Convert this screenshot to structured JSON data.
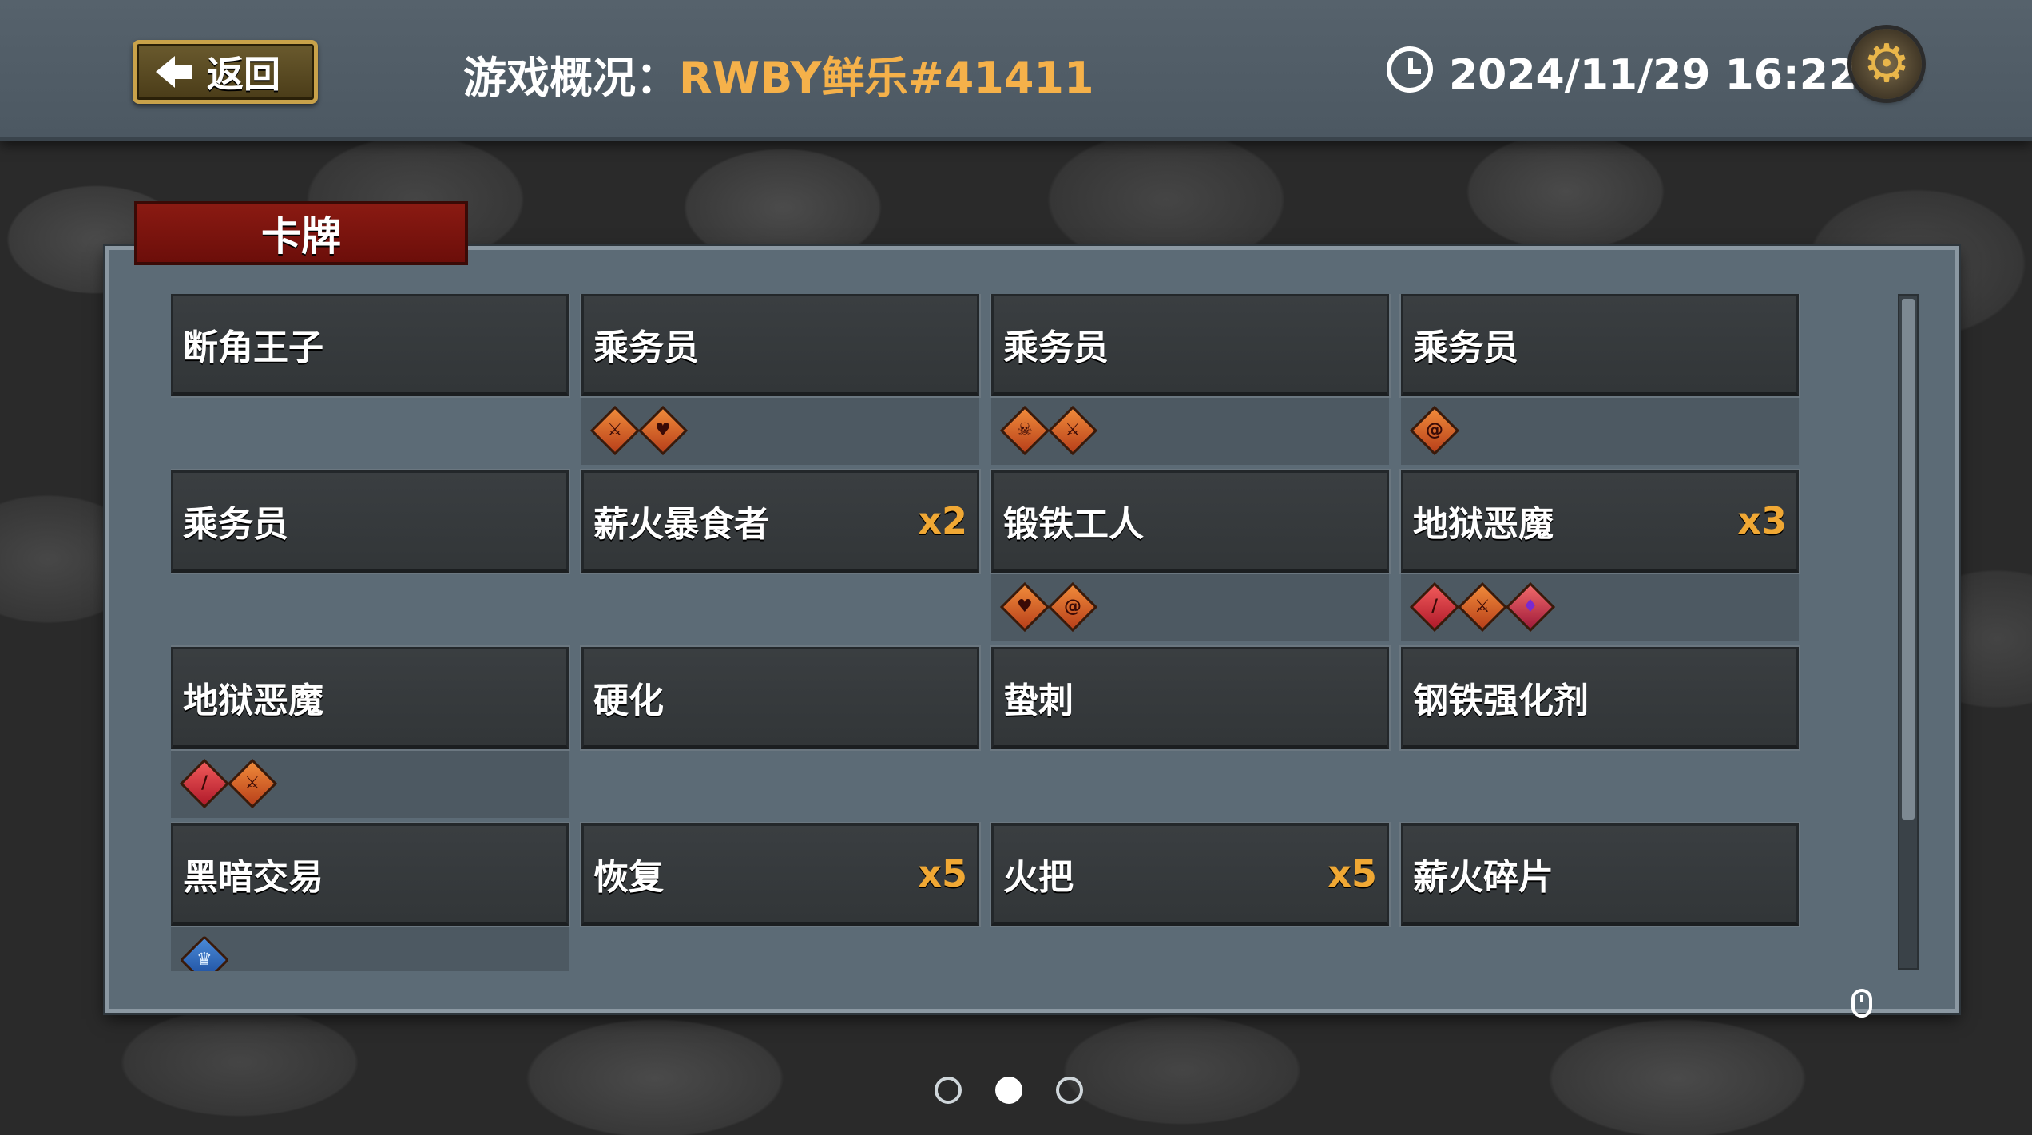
{
  "header": {
    "back_label": "返回",
    "title_prefix": "游戏概况：",
    "player_name": "RWBY鲜乐#41411",
    "datetime": "2024/11/29 16:22"
  },
  "panel": {
    "tab_label": "卡牌"
  },
  "cards": [
    {
      "name": "断角王子",
      "count": "",
      "tags": []
    },
    {
      "name": "乘务员",
      "count": "",
      "tags": [
        {
          "icon": "sword-icon",
          "glyph": "⚔",
          "kind": "orange"
        },
        {
          "icon": "heart-icon",
          "glyph": "♥",
          "kind": "orange"
        }
      ]
    },
    {
      "name": "乘务员",
      "count": "",
      "tags": [
        {
          "icon": "demon-icon",
          "glyph": "☠",
          "kind": "orange"
        },
        {
          "icon": "sword-icon",
          "glyph": "⚔",
          "kind": "orange"
        }
      ]
    },
    {
      "name": "乘务员",
      "count": "",
      "tags": [
        {
          "icon": "spiral-icon",
          "glyph": "@",
          "kind": "orange"
        }
      ]
    },
    {
      "name": "乘务员",
      "count": "",
      "tags": []
    },
    {
      "name": "薪火暴食者",
      "count": "x2",
      "tags": []
    },
    {
      "name": "锻铁工人",
      "count": "",
      "tags": [
        {
          "icon": "heart-icon",
          "glyph": "♥",
          "kind": "orange"
        },
        {
          "icon": "spiral-icon",
          "glyph": "@",
          "kind": "orange"
        }
      ]
    },
    {
      "name": "地狱恶魔",
      "count": "x3",
      "tags": [
        {
          "icon": "slash-icon",
          "glyph": "/",
          "kind": "red"
        },
        {
          "icon": "sword-icon",
          "glyph": "⚔",
          "kind": "orange"
        },
        {
          "icon": "crystal-icon",
          "glyph": "♦",
          "kind": "purple"
        }
      ]
    },
    {
      "name": "地狱恶魔",
      "count": "",
      "tags": [
        {
          "icon": "slash-icon",
          "glyph": "/",
          "kind": "red"
        },
        {
          "icon": "sword-icon",
          "glyph": "⚔",
          "kind": "orange"
        }
      ]
    },
    {
      "name": "硬化",
      "count": "",
      "tags": []
    },
    {
      "name": "蛰刺",
      "count": "",
      "tags": []
    },
    {
      "name": "钢铁强化剂",
      "count": "",
      "tags": []
    },
    {
      "name": "黑暗交易",
      "count": "",
      "tags": [
        {
          "icon": "crown-icon",
          "glyph": "♛",
          "kind": "blue"
        }
      ]
    },
    {
      "name": "恢复",
      "count": "x5",
      "tags": []
    },
    {
      "name": "火把",
      "count": "x5",
      "tags": []
    },
    {
      "name": "薪火碎片",
      "count": "",
      "tags": []
    }
  ],
  "pagination": {
    "total": 3,
    "current": 2
  },
  "icons": {
    "back": "arrow-left-icon",
    "clock": "clock-icon",
    "settings": "gear-icon",
    "mouse": "mouse-icon"
  },
  "colors": {
    "accent": "#f5b14a",
    "count": "#f0a834",
    "tab": "#7a140e"
  }
}
